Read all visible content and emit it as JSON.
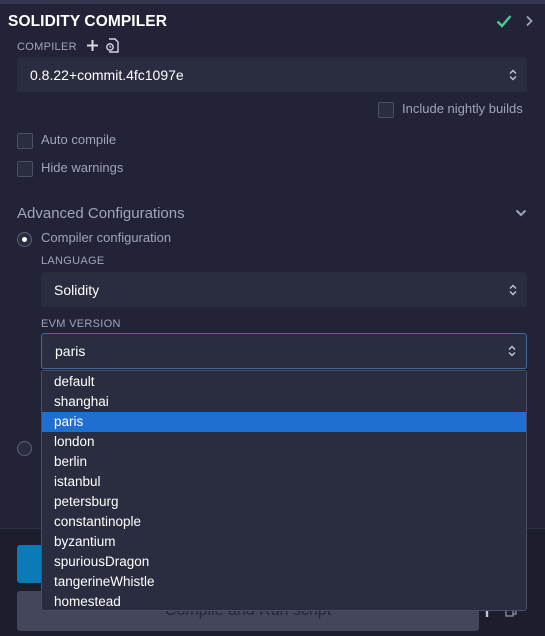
{
  "header": {
    "title": "SOLIDITY COMPILER"
  },
  "compiler": {
    "label": "COMPILER",
    "version": "0.8.22+commit.4fc1097e",
    "include_nightly_label": "Include nightly builds",
    "auto_compile_label": "Auto compile",
    "hide_warnings_label": "Hide warnings"
  },
  "advanced": {
    "title": "Advanced Configurations",
    "compiler_configuration_label": "Compiler configuration",
    "language_label": "LANGUAGE",
    "language_value": "Solidity",
    "evm_label": "EVM VERSION",
    "evm_value": "paris",
    "evm_options": [
      "default",
      "shanghai",
      "paris",
      "london",
      "berlin",
      "istanbul",
      "petersburg",
      "constantinople",
      "byzantium",
      "spuriousDragon",
      "tangerineWhistle",
      "homestead"
    ],
    "evm_selected": "paris"
  },
  "actions": {
    "run_script_label": "Compile and Run script"
  },
  "colors": {
    "accent_check": "#4fc98e",
    "selected_option": "#1f6fd0",
    "primary_button": "#0b7bb7"
  }
}
